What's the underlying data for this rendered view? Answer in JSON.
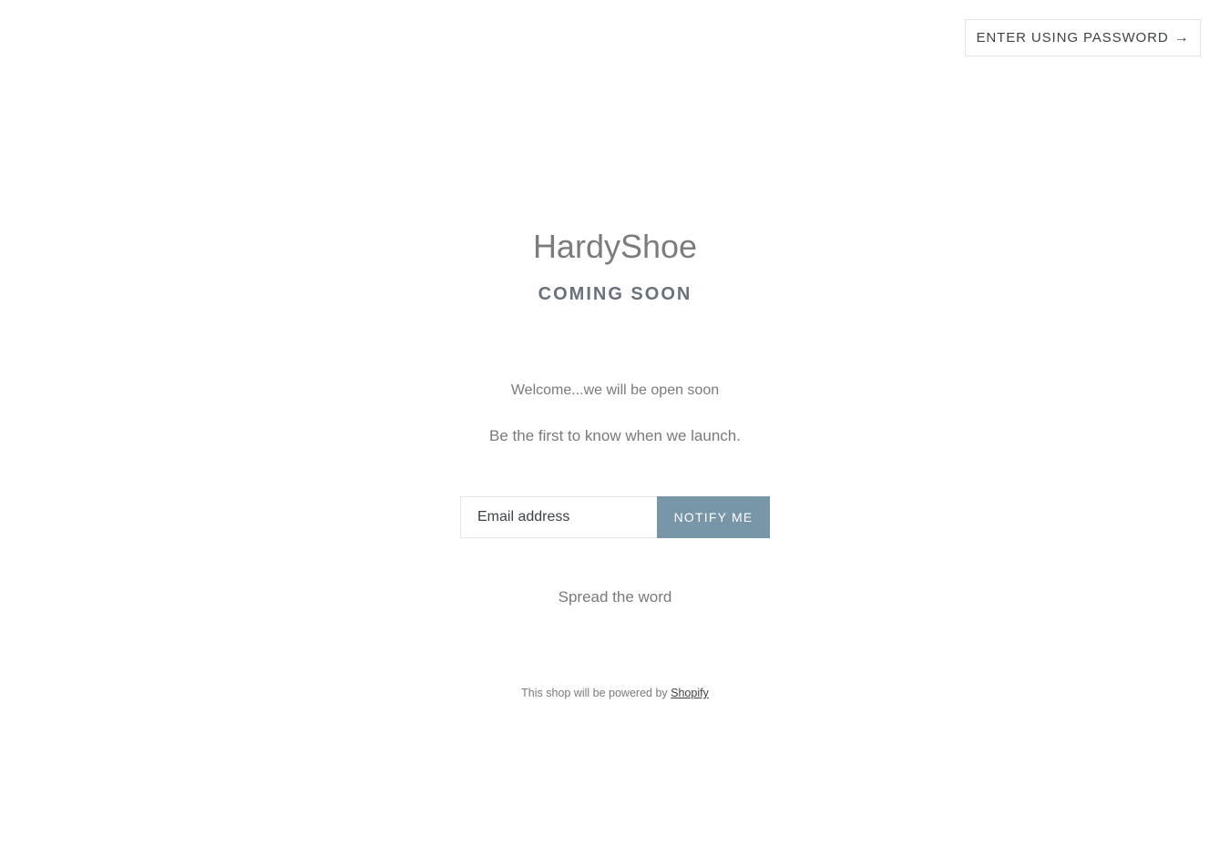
{
  "header": {
    "password_button_label": "ENTER USING PASSWORD",
    "password_button_arrow": "→"
  },
  "store": {
    "name": "HardyShoe",
    "status": "COMING SOON"
  },
  "message": {
    "welcome": "Welcome...we will be open soon",
    "first_to_know": "Be the first to know when we launch."
  },
  "signup": {
    "email_placeholder": "Email address",
    "email_value": "",
    "submit_label": "NOTIFY ME"
  },
  "share": {
    "label": "Spread the word"
  },
  "footer": {
    "powered_prefix": "This shop will be powered by",
    "powered_link": "Shopify"
  },
  "colors": {
    "accent": "#7796a8",
    "text": "#7a7a7a",
    "dark_text": "#3d4246",
    "border": "#e3e3e3"
  }
}
